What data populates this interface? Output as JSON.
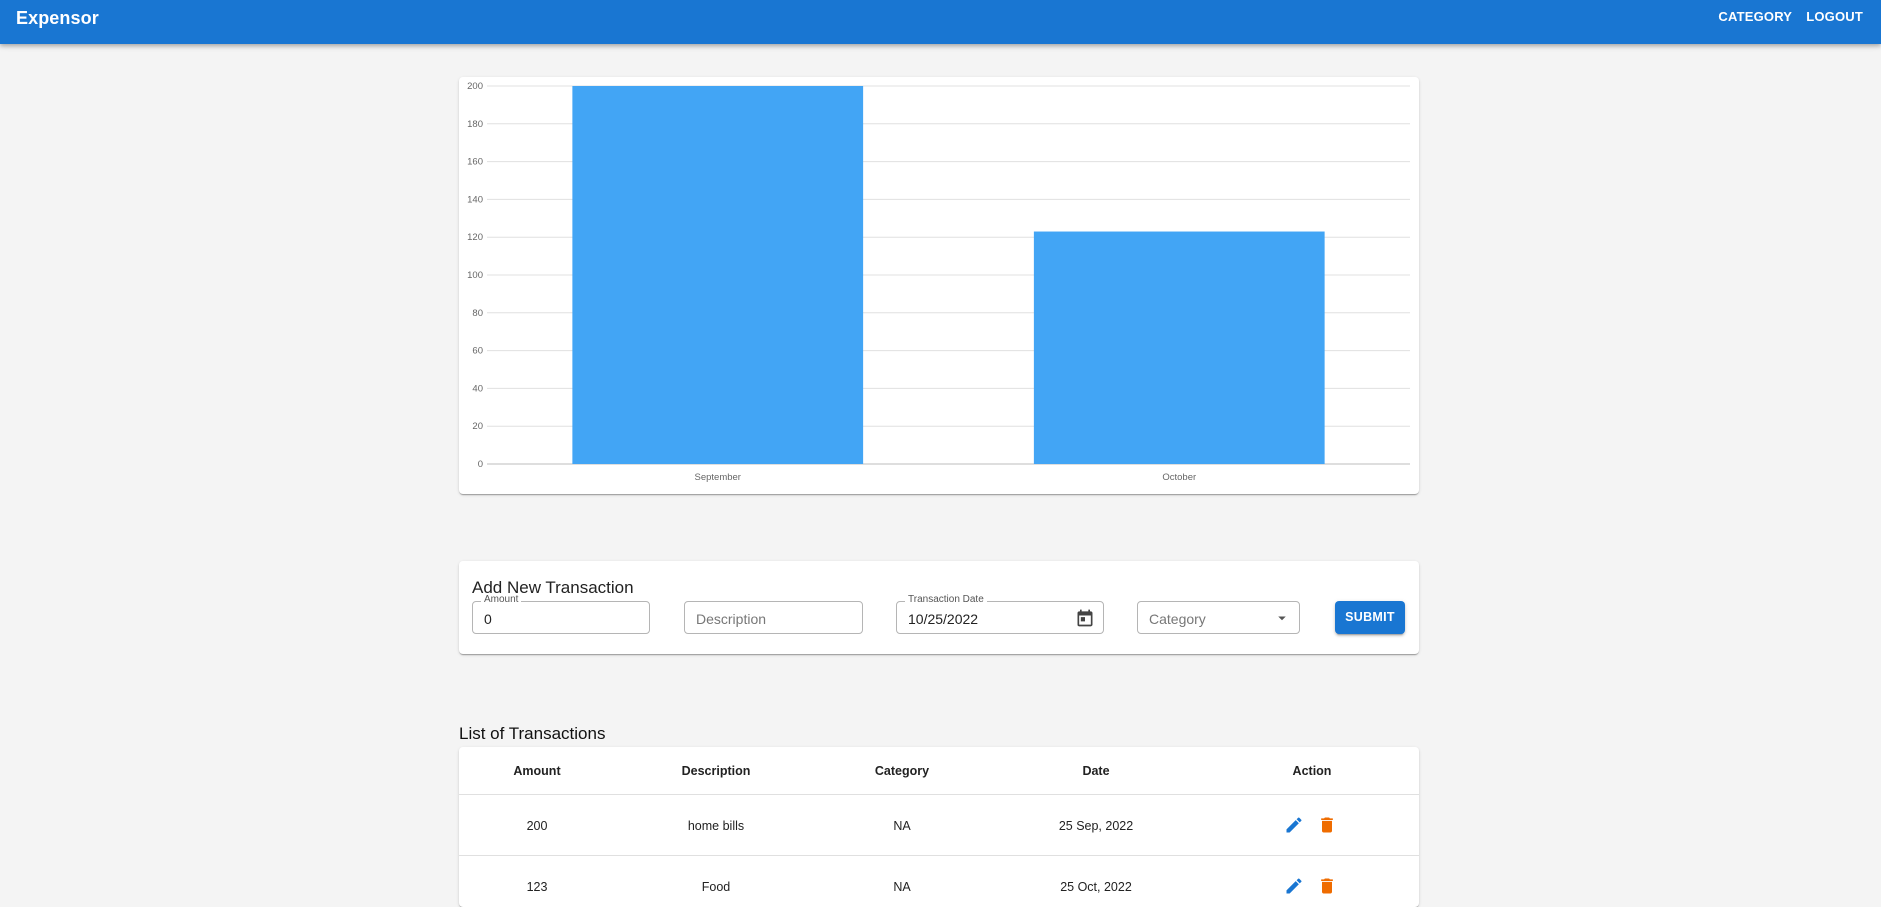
{
  "appbar": {
    "title": "Expensor",
    "links": [
      "CATEGORY",
      "LOGOUT"
    ]
  },
  "chart_data": {
    "type": "bar",
    "categories": [
      "September",
      "October"
    ],
    "values": [
      200,
      123
    ],
    "ylim": [
      0,
      200
    ],
    "yticks": [
      0,
      20,
      40,
      60,
      80,
      100,
      120,
      140,
      160,
      180,
      200
    ],
    "grid": true,
    "bar_color": "#42a5f5"
  },
  "form": {
    "title": "Add New Transaction",
    "amount_label": "Amount",
    "amount_value": "0",
    "description_placeholder": "Description",
    "date_label": "Transaction Date",
    "date_value": "10/25/2022",
    "category_placeholder": "Category",
    "submit_label": "SUBMIT"
  },
  "list": {
    "title": "List of Transactions",
    "columns": [
      "Amount",
      "Description",
      "Category",
      "Date",
      "Action"
    ],
    "rows": [
      {
        "amount": "200",
        "description": "home bills",
        "category": "NA",
        "date": "25 Sep, 2022"
      },
      {
        "amount": "123",
        "description": "Food",
        "category": "NA",
        "date": "25 Oct, 2022"
      }
    ]
  },
  "colors": {
    "primary": "#1976d2",
    "edit_icon": "#1976d2",
    "delete_icon": "#ef6c00",
    "background": "#f4f4f4"
  },
  "icons": {
    "date_picker": "calendar-icon",
    "category_dropdown": "arrow-drop-down-icon",
    "edit": "pencil-icon",
    "delete": "trash-icon"
  }
}
